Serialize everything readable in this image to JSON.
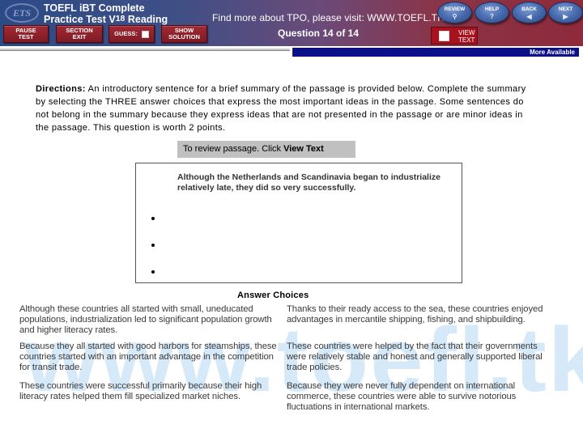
{
  "header": {
    "logo_text": "ETS",
    "title_line1": "TOEFL iBT Complete",
    "title_line2_prefix": "Practice Test V",
    "title_version": "18",
    "title_line2_suffix": " Reading",
    "promo_text": "Find more about TPO,  please visit:  WWW.TOEFL.TK",
    "question_counter": "Question 14 of 14",
    "toolbar": {
      "pause_test": "PAUSE TEST",
      "section_exit": "SECTION EXIT",
      "guess": "GUESS:",
      "show_solution": "SHOW SOLUTION"
    },
    "nav": {
      "review": "REVIEW",
      "help": "HELP",
      "back": "BACK",
      "next": "NEXT"
    },
    "view_text": {
      "line1": "VIEW",
      "line2": "TEXT"
    },
    "more_available": "More Available"
  },
  "directions": {
    "label": "Directions:",
    "text": " An introductory sentence for a brief summary of the passage is provided below. Complete the summary by selecting the THREE answer choices that express the most important ideas in the passage. Some sentences do not belong in the summary because they express ideas that are not presented in the passage or are minor ideas in the passage. This question is worth 2 points."
  },
  "review_prompt": {
    "text": "To review passage. Click ",
    "link": "View Text"
  },
  "summary": {
    "intro_sentence": "Although the Netherlands and Scandinavia began to industrialize relatively late, they did so very successfully.",
    "slots": [
      "",
      "",
      ""
    ]
  },
  "answer_choices": {
    "heading": "Answer Choices",
    "items": [
      "Although these countries all started with small, uneducated populations, industrialization led to significant population growth and higher literacy rates.",
      "Thanks to their ready access to the sea, these countries enjoyed advantages in mercantile shipping, fishing, and shipbuilding.",
      "Because they all started with good harbors for steamships, these countries started with an important advantage in the competition for transit trade.",
      "These countries were helped by the fact that their governments were relatively stable and honest and generally supported liberal trade policies.",
      "These countries were successful primarily because their high literacy rates helped them fill specialized market niches.",
      "Because they were never fully dependent on international commerce, these countries were able to survive notorious fluctuations in international markets."
    ]
  },
  "watermark": "www.toefl.tk",
  "colors": {
    "header_blue": "#2c4a86",
    "header_red": "#8e2a3a",
    "button_red": "#a22a34",
    "more_bar": "#0c0f8a",
    "review_bar": "#c0c0c0"
  }
}
